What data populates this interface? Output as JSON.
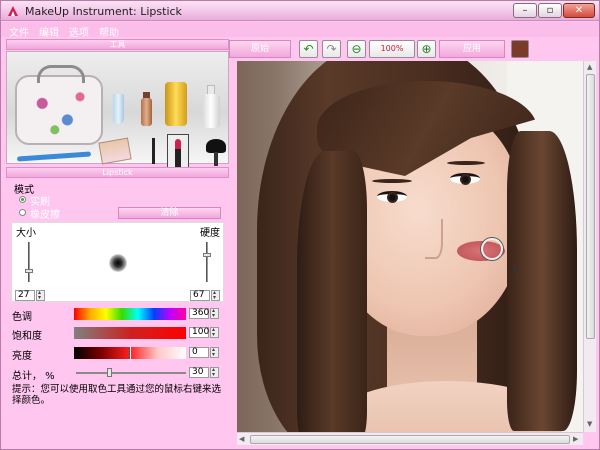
{
  "window": {
    "title": "MakeUp Instrument: Lipstick",
    "controls": {
      "minimize": "–",
      "maximize": "▫",
      "close": "✕"
    }
  },
  "menu": {
    "items": [
      "文件",
      "编辑",
      "选项",
      "帮助"
    ]
  },
  "left_panel": {
    "tools_header": "工具",
    "tool_icons": [
      "cosmetic-bag-icon",
      "cream-tube-icon",
      "foundation-bottle-icon",
      "jar-icon",
      "lotion-bottle-icon",
      "toothbrush-icon",
      "eyeshadow-palette-icon",
      "eyeliner-pencil-icon",
      "lipstick-icon",
      "brush-icon"
    ],
    "section_header": "Lipstick",
    "mode_label": "模式",
    "mode_options": [
      {
        "label": "实刷",
        "checked": true
      },
      {
        "label": "橡皮擦",
        "checked": false
      }
    ],
    "clear_button": "清除",
    "size_label": "大小",
    "hardness_label": "硬度",
    "size_value": "27",
    "hardness_value": "67",
    "size_level": 0.27,
    "hardness_level": 0.67,
    "hue": {
      "label": "色调",
      "value": "360"
    },
    "saturation": {
      "label": "饱和度",
      "value": "100"
    },
    "brightness": {
      "label": "亮度",
      "value": "0"
    },
    "total": {
      "label": "总计， %",
      "value": "30",
      "level": 0.3
    },
    "hint": "提示：您可以使用取色工具通过您的鼠标右键来选择颜色。"
  },
  "toolbar": {
    "original_button": "原始",
    "apply_button": "应用",
    "icons": [
      "undo-icon",
      "redo-icon",
      "zoom-out-icon",
      "zoom-100-icon",
      "zoom-in-icon",
      "image-thumbnail-icon"
    ],
    "zoom_label": "100%"
  },
  "colors": {
    "window_bg": "#ffc6f0",
    "accent": "#f3a6dd"
  }
}
